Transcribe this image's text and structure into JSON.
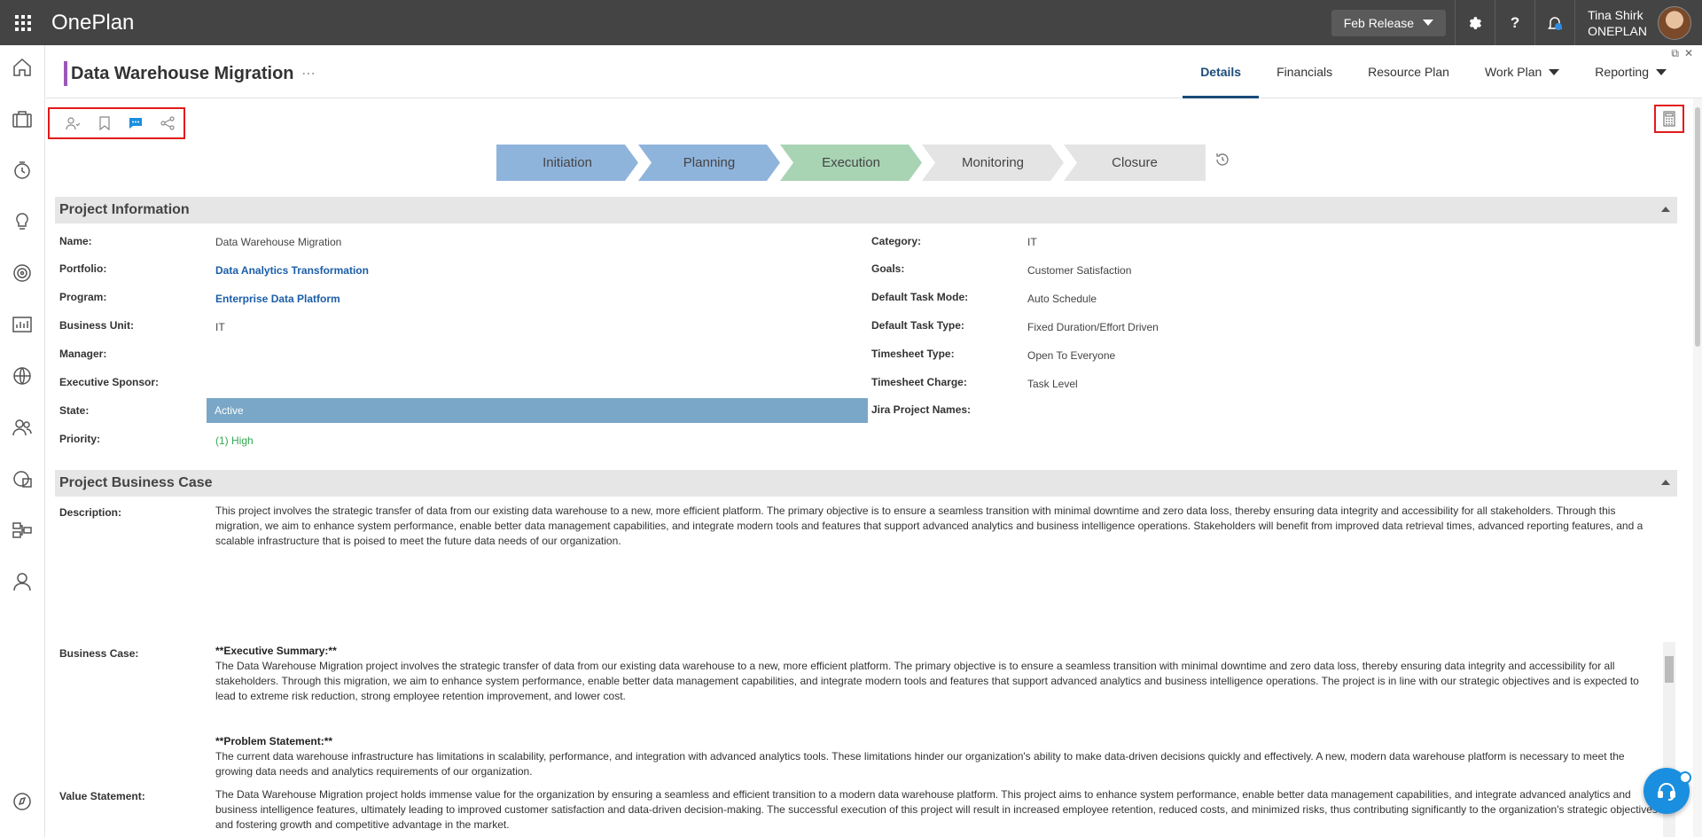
{
  "app": {
    "brand": "OnePlan",
    "release_label": "Feb Release",
    "help_label": "?",
    "user": {
      "name": "Tina Shirk",
      "org": "ONEPLAN"
    }
  },
  "page": {
    "title": "Data Warehouse Migration",
    "more": "⋯",
    "tabs": [
      {
        "label": "Details",
        "active": true
      },
      {
        "label": "Financials"
      },
      {
        "label": "Resource Plan"
      },
      {
        "label": "Work Plan"
      },
      {
        "label": "Reporting"
      }
    ]
  },
  "stages": [
    "Initiation",
    "Planning",
    "Execution",
    "Monitoring",
    "Closure"
  ],
  "colors": {
    "stage_done": "#8fb4dc",
    "stage_current": "#a8d4b4",
    "stage_future": "#e4e4e4",
    "accent": "#9b59b6"
  },
  "project_information": {
    "header": "Project Information",
    "left": [
      {
        "label": "Name:",
        "value": "Data Warehouse Migration"
      },
      {
        "label": "Portfolio:",
        "value": "Data Analytics Transformation"
      },
      {
        "label": "Program:",
        "value": "Enterprise Data Platform"
      },
      {
        "label": "Business Unit:",
        "value": "IT"
      },
      {
        "label": "Manager:",
        "value": ""
      },
      {
        "label": "Executive Sponsor:",
        "value": ""
      },
      {
        "label": "State:",
        "value": "Active"
      },
      {
        "label": "Priority:",
        "value": "(1) High"
      }
    ],
    "right": [
      {
        "label": "Category:",
        "value": "IT"
      },
      {
        "label": "Goals:",
        "value": "Customer Satisfaction"
      },
      {
        "label": "Default Task Mode:",
        "value": "Auto Schedule"
      },
      {
        "label": "Default Task Type:",
        "value": "Fixed Duration/Effort Driven"
      },
      {
        "label": "Timesheet Type:",
        "value": "Open To Everyone"
      },
      {
        "label": "Timesheet Charge:",
        "value": "Task Level"
      },
      {
        "label": "Jira Project Names:",
        "value": ""
      }
    ]
  },
  "business_case": {
    "header": "Project Business Case",
    "description_label": "Description:",
    "description": "This project involves the strategic transfer of data from our existing data warehouse to a new, more efficient platform. The primary objective is to ensure a seamless transition with minimal downtime and zero data loss, thereby ensuring data integrity and accessibility for all stakeholders. Through this migration, we aim to enhance system performance, enable better data management capabilities, and integrate modern tools and features that support advanced analytics and business intelligence operations. Stakeholders will benefit from improved data retrieval times, advanced reporting features, and a scalable infrastructure that is poised to meet the future data needs of our organization.",
    "business_case_label": "Business Case:",
    "exec_summary_heading": "**Executive Summary:**",
    "exec_summary": "The Data Warehouse Migration project involves the strategic transfer of data from our existing data warehouse to a new, more efficient platform. The primary objective is to ensure a seamless transition with minimal downtime and zero data loss, thereby ensuring data integrity and accessibility for all stakeholders. Through this migration, we aim to enhance system performance, enable better data management capabilities, and integrate modern tools and features that support advanced analytics and business intelligence operations. The project is in line with our strategic objectives and is expected to lead to extreme risk reduction, strong employee retention improvement, and lower cost.",
    "problem_heading": "**Problem Statement:**",
    "problem": "The current data warehouse infrastructure has limitations in scalability, performance, and integration with advanced analytics tools. These limitations hinder our organization's ability to make data-driven decisions quickly and effectively. A new, modern data warehouse platform is necessary to meet the growing data needs and analytics requirements of our organization.",
    "value_label": "Value Statement:",
    "value": "The Data Warehouse Migration project holds immense value for the organization by ensuring a seamless and efficient transition to a modern data warehouse platform. This project aims to enhance system performance, enable better data management capabilities, and integrate advanced analytics and business intelligence features, ultimately leading to improved customer satisfaction and data-driven decision-making. The successful execution of this project will result in increased employee retention, reduced costs, and minimized risks, thus contributing significantly to the organization's strategic objectives and fostering growth and competitive advantage in the market."
  }
}
